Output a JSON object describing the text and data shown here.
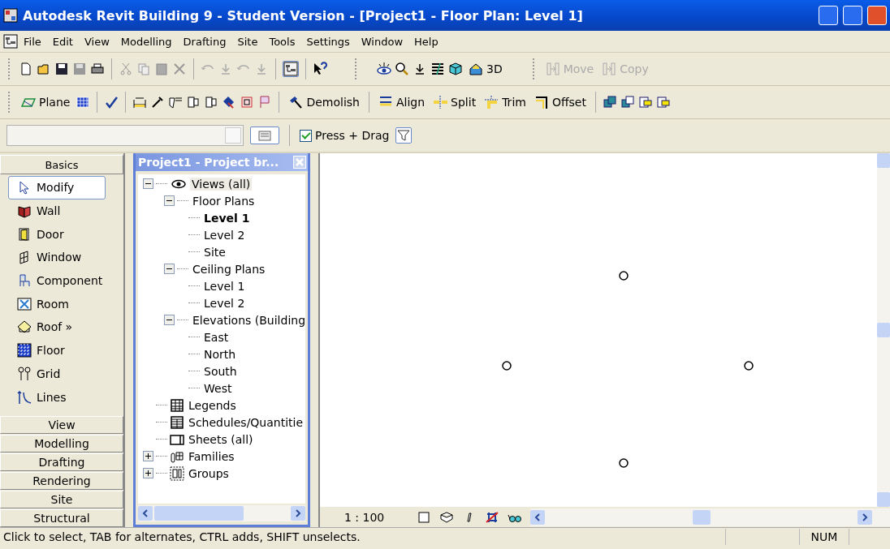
{
  "window": {
    "title": "Autodesk Revit Building 9 - Student Version - [Project1 - Floor Plan: Level 1]"
  },
  "menu": [
    "File",
    "Edit",
    "View",
    "Modelling",
    "Drafting",
    "Site",
    "Tools",
    "Settings",
    "Window",
    "Help"
  ],
  "toolbar_1": {
    "view_3d_label": "3D",
    "buttons": [
      {
        "label": "Move",
        "disabled": true
      },
      {
        "label": "Copy",
        "disabled": true
      }
    ]
  },
  "toolbar_2": {
    "buttons": [
      {
        "label": "Plane"
      },
      {
        "label": "Demolish"
      },
      {
        "label": "Align"
      },
      {
        "label": "Split"
      },
      {
        "label": "Trim"
      },
      {
        "label": "Offset"
      }
    ]
  },
  "options_bar": {
    "press_drag": {
      "label": "Press + Drag",
      "checked": true
    }
  },
  "design_bar": {
    "header": "Basics",
    "tools": [
      {
        "label": "Modify",
        "selected": true
      },
      {
        "label": "Wall",
        "selected": false
      },
      {
        "label": "Door",
        "selected": false
      },
      {
        "label": "Window",
        "selected": false
      },
      {
        "label": "Component",
        "selected": false
      },
      {
        "label": "Room",
        "selected": false
      },
      {
        "label": "Roof »",
        "selected": false
      },
      {
        "label": "Floor",
        "selected": false
      },
      {
        "label": "Grid",
        "selected": false
      },
      {
        "label": "Lines",
        "selected": false
      }
    ],
    "tabs": [
      "View",
      "Modelling",
      "Drafting",
      "Rendering",
      "Site",
      "Structural"
    ]
  },
  "project_browser": {
    "title": "Project1 - Project br...",
    "tree": [
      {
        "kind": "views",
        "label": "Views (all)",
        "selected": true,
        "current": false,
        "expanded": true,
        "children": [
          {
            "label": "Floor Plans",
            "selected": false,
            "current": false,
            "expanded": true,
            "children": [
              {
                "label": "Level 1",
                "selected": false,
                "current": true
              },
              {
                "label": "Level 2",
                "selected": false,
                "current": false
              },
              {
                "label": "Site",
                "selected": false,
                "current": false
              }
            ]
          },
          {
            "label": "Ceiling Plans",
            "selected": false,
            "current": false,
            "expanded": true,
            "children": [
              {
                "label": "Level 1",
                "selected": false,
                "current": false
              },
              {
                "label": "Level 2",
                "selected": false,
                "current": false
              }
            ]
          },
          {
            "label": "Elevations (Building",
            "selected": false,
            "current": false,
            "expanded": true,
            "children": [
              {
                "label": "East",
                "selected": false,
                "current": false
              },
              {
                "label": "North",
                "selected": false,
                "current": false
              },
              {
                "label": "South",
                "selected": false,
                "current": false
              },
              {
                "label": "West",
                "selected": false,
                "current": false
              }
            ]
          }
        ]
      },
      {
        "kind": "legends",
        "label": "Legends",
        "selected": false,
        "current": false
      },
      {
        "kind": "schedules",
        "label": "Schedules/Quantitie",
        "selected": false,
        "current": false
      },
      {
        "kind": "sheets",
        "label": "Sheets (all)",
        "selected": false,
        "current": false
      },
      {
        "kind": "families",
        "label": "Families",
        "selected": false,
        "current": false,
        "expanded": false
      },
      {
        "kind": "groups",
        "label": "Groups",
        "selected": false,
        "current": false,
        "expanded": false
      }
    ]
  },
  "view": {
    "scale": "1 : 100"
  },
  "status_bar": {
    "message": "Click to select, TAB for alternates, CTRL adds, SHIFT unselects.",
    "indicator": "NUM"
  }
}
